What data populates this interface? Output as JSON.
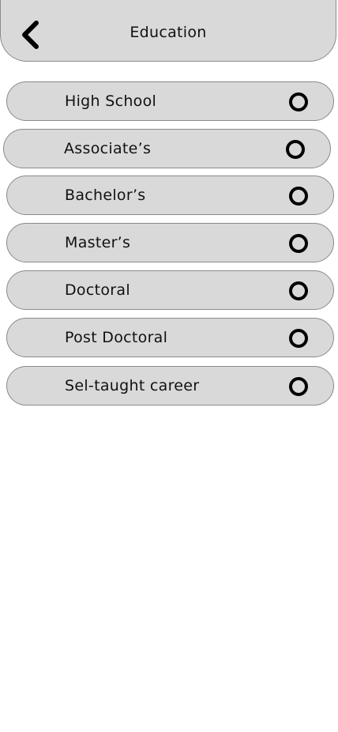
{
  "header": {
    "title": "Education",
    "back_icon": "chevron-left-icon"
  },
  "options": [
    {
      "label": "High School",
      "selected": false
    },
    {
      "label": "Associate’s",
      "selected": false
    },
    {
      "label": "Bachelor’s",
      "selected": false
    },
    {
      "label": "Master’s",
      "selected": false
    },
    {
      "label": "Doctoral",
      "selected": false
    },
    {
      "label": "Post Doctoral",
      "selected": false
    },
    {
      "label": "Sel-taught career",
      "selected": false
    }
  ],
  "colors": {
    "surface": "#d9d9d9",
    "border": "#8a8a8a",
    "text": "#111111",
    "radio": "#000000"
  }
}
